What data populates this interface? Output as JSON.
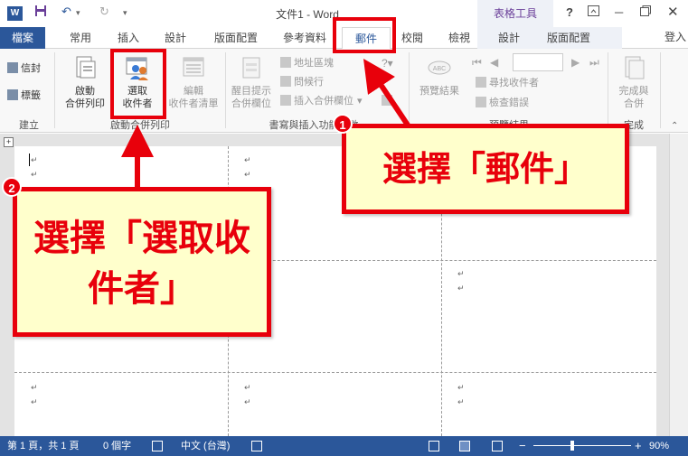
{
  "titlebar": {
    "logo": "W",
    "doc_title": "文件1 - Word",
    "context_group": "表格工具",
    "help": "?",
    "qat_icons": [
      "save-icon",
      "undo-icon",
      "redo-icon",
      "customize-icon"
    ]
  },
  "tabs": {
    "file": "檔案",
    "items": [
      "常用",
      "插入",
      "設計",
      "版面配置",
      "參考資料",
      "郵件",
      "校閱",
      "檢視"
    ],
    "context_items": [
      "設計",
      "版面配置"
    ],
    "signin": "登入",
    "active": "郵件"
  },
  "ribbon": {
    "groups": {
      "create": {
        "label": "建立",
        "envelopes": "信封",
        "labels": "標籤"
      },
      "start_merge": {
        "label": "啟動合併列印",
        "start_line1": "啟動",
        "start_line2": "合併列印",
        "select_line1": "選取",
        "select_line2": "收件者",
        "edit_line1": "編輯",
        "edit_line2": "收件者清單"
      },
      "write_insert": {
        "label": "書寫與插入功能變數",
        "highlight_line1": "醒目提示",
        "highlight_line2": "合併欄位",
        "address_block": "地址區塊",
        "greeting_line": "問候行",
        "insert_field": "插入合併欄位"
      },
      "preview": {
        "label": "預覽結果",
        "preview_results": "預覽結果",
        "find_recipient": "尋找收件者",
        "check_errors": "檢查錯誤"
      },
      "finish": {
        "label": "完成",
        "finish_line1": "完成與",
        "finish_line2": "合併"
      }
    }
  },
  "document": {
    "paragraph_mark": "↵",
    "anchor": "+"
  },
  "statusbar": {
    "page": "第 1 頁，共 1 頁",
    "words": "0 個字",
    "language": "中文 (台灣)",
    "zoom": "90%",
    "zoom_minus": "−",
    "zoom_plus": "+"
  },
  "callouts": {
    "step1_number": "1",
    "step1_text": "選擇「郵件」",
    "step2_number": "2",
    "step2_text": "選擇「選取收件者」"
  }
}
